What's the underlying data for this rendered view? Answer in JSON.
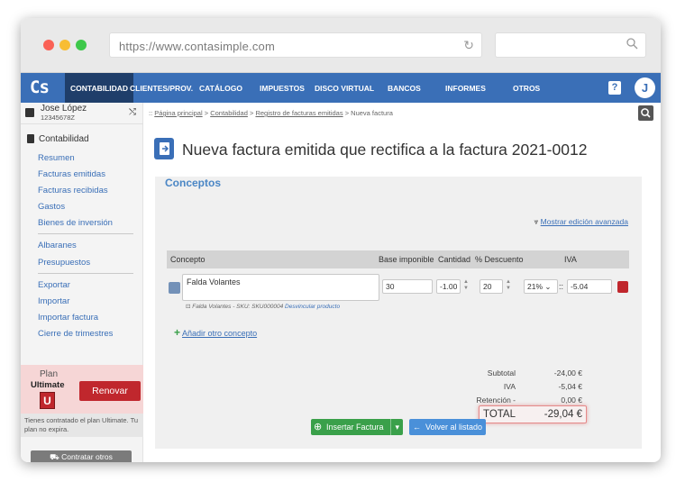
{
  "browser": {
    "url": "https://www.contasimple.com",
    "dots": [
      "#fa6156",
      "#f8bd34",
      "#3ec84a"
    ]
  },
  "nav": {
    "logo": "Cs",
    "items": [
      {
        "label": "CONTABILIDAD",
        "active": true
      },
      {
        "label": "CLIENTES/PROV."
      },
      {
        "label": "CATÁLOGO"
      },
      {
        "label": "IMPUESTOS"
      },
      {
        "label": "DISCO VIRTUAL"
      },
      {
        "label": "BANCOS"
      },
      {
        "label": "INFORMES"
      },
      {
        "label": "OTROS"
      }
    ],
    "help": "?",
    "avatar": "J"
  },
  "user": {
    "name": "Jose López",
    "id": "12345678Z"
  },
  "sidebar": {
    "section": "Contabilidad",
    "links": [
      "Resumen",
      "Facturas emitidas",
      "Facturas recibidas",
      "Gastos",
      "Bienes de inversión"
    ],
    "links2": [
      "Albaranes",
      "Presupuestos"
    ],
    "links3": [
      "Exportar",
      "Importar",
      "Importar factura",
      "Cierre de trimestres"
    ],
    "plan_label": "Plan",
    "plan_name": "Ultimate",
    "plan_badge": "U",
    "renew": "Renovar",
    "plan_note": "Tienes contratado el plan Ultimate. Tu plan no expira.",
    "contract_others": "Contratar otros"
  },
  "breadcrumb": {
    "sep": "::",
    "items": [
      "Página principal",
      "Contabilidad",
      "Registro de facturas emitidas",
      "Nueva factura"
    ]
  },
  "page_title": "Nueva factura emitida que rectifica a la factura 2021-0012",
  "panel": {
    "title": "Conceptos",
    "advanced": "Mostrar edición avanzada",
    "headers": {
      "concept": "Concepto",
      "base": "Base imponible",
      "qty": "Cantidad",
      "disc": "% Descuento",
      "iva": "IVA"
    },
    "row": {
      "concept": "Falda Volantes",
      "base": "30",
      "qty": "-1.00",
      "disc": "20",
      "iva_rate": "21%",
      "iva_sep": "::",
      "iva_amount": "-5.04"
    },
    "sku_text": "Falda Volantes - SKU: SKU000004",
    "unlink": "Desvincular producto",
    "add_concept": "Añadir otro concepto",
    "totals": {
      "subtotal_label": "Subtotal",
      "subtotal": "-24,00 €",
      "iva_label": "IVA",
      "iva": "-5,04 €",
      "ret_label": "Retención -",
      "ret": "0,00 €",
      "total_label": "TOTAL",
      "total": "-29,04 €"
    },
    "insert": "Insertar Factura",
    "back": "Volver al listado"
  }
}
